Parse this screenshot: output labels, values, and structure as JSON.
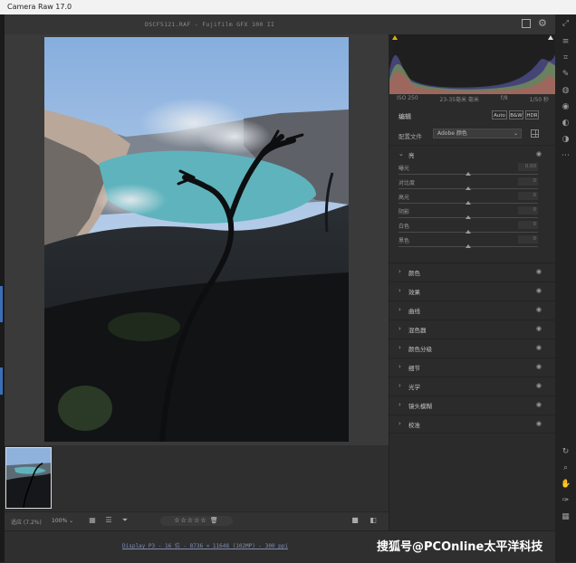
{
  "window": {
    "title": "Camera Raw 17.0"
  },
  "document": {
    "filename": "DSCF5121.RAF - Fujifilm GFX 100 II",
    "zoom_label": "适应 (7.2%)",
    "zoom_value": "100%",
    "rating_stars": "☆☆☆☆☆",
    "workflow": "Display P3 - 16 位 - 8736 × 11648 (102MP) - 300 ppi"
  },
  "panel": {
    "camera_info": [
      "ISO 250",
      "23-35毫米 毫米",
      "f/8",
      "1/50 秒"
    ],
    "edit_label": "编辑",
    "buttons": {
      "auto": "Auto",
      "bw": "B&W",
      "hdr": "HDR"
    },
    "profile_label": "配置文件",
    "profile_value": "Adobe 颜色",
    "light_section": "亮",
    "sliders": [
      {
        "name": "曝光",
        "value": "0.00"
      },
      {
        "name": "对比度",
        "value": "0"
      },
      {
        "name": "高光",
        "value": "0"
      },
      {
        "name": "阴影",
        "value": "0"
      },
      {
        "name": "白色",
        "value": "0"
      },
      {
        "name": "黑色",
        "value": "0"
      }
    ],
    "sections": [
      "颜色",
      "效果",
      "曲线",
      "混色器",
      "颜色分级",
      "细节",
      "光学",
      "镜头模糊",
      "校准"
    ]
  },
  "watermark": "搜狐号@PCOnline太平洋科技",
  "icons": {
    "export": "export-icon",
    "settings": "gear-icon",
    "eye": "eye-icon",
    "expand": "chevron-right-icon",
    "collapse": "chevron-down-icon"
  },
  "colors": {
    "panel_bg": "#2b2b2b",
    "canvas_bg": "#3a3a3a",
    "link_blue": "#7f8db0"
  }
}
